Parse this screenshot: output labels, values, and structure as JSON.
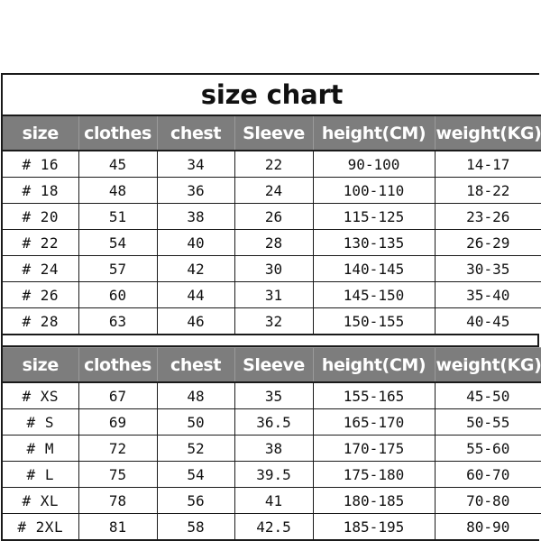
{
  "title": "size chart",
  "columns": [
    "size",
    "clothes",
    "chest",
    "Sleeve",
    "height(CM)",
    "weight(KG)"
  ],
  "tables": [
    {
      "headers": [
        "size",
        "clothes",
        "chest",
        "Sleeve",
        "height(CM)",
        "weight(KG)"
      ],
      "rows": [
        [
          "# 16",
          "45",
          "34",
          "22",
          "90-100",
          "14-17"
        ],
        [
          "# 18",
          "48",
          "36",
          "24",
          "100-110",
          "18-22"
        ],
        [
          "# 20",
          "51",
          "38",
          "26",
          "115-125",
          "23-26"
        ],
        [
          "# 22",
          "54",
          "40",
          "28",
          "130-135",
          "26-29"
        ],
        [
          "# 24",
          "57",
          "42",
          "30",
          "140-145",
          "30-35"
        ],
        [
          "# 26",
          "60",
          "44",
          "31",
          "145-150",
          "35-40"
        ],
        [
          "# 28",
          "63",
          "46",
          "32",
          "150-155",
          "40-45"
        ]
      ]
    },
    {
      "headers": [
        "size",
        "clothes",
        "chest",
        "Sleeve",
        "height(CM)",
        "weight(KG)"
      ],
      "rows": [
        [
          "# XS",
          "67",
          "48",
          "35",
          "155-165",
          "45-50"
        ],
        [
          "# S",
          "69",
          "50",
          "36.5",
          "165-170",
          "50-55"
        ],
        [
          "# M",
          "72",
          "52",
          "38",
          "170-175",
          "55-60"
        ],
        [
          "# L",
          "75",
          "54",
          "39.5",
          "175-180",
          "60-70"
        ],
        [
          "# XL",
          "78",
          "56",
          "41",
          "180-185",
          "70-80"
        ],
        [
          "# 2XL",
          "81",
          "58",
          "42.5",
          "185-195",
          "80-90"
        ]
      ]
    }
  ],
  "colors": {
    "header_background": "#7d7d7d",
    "header_text": "#ffffff",
    "border": "#1a1a1a",
    "body_background": "#ffffff",
    "body_text": "#111111"
  }
}
